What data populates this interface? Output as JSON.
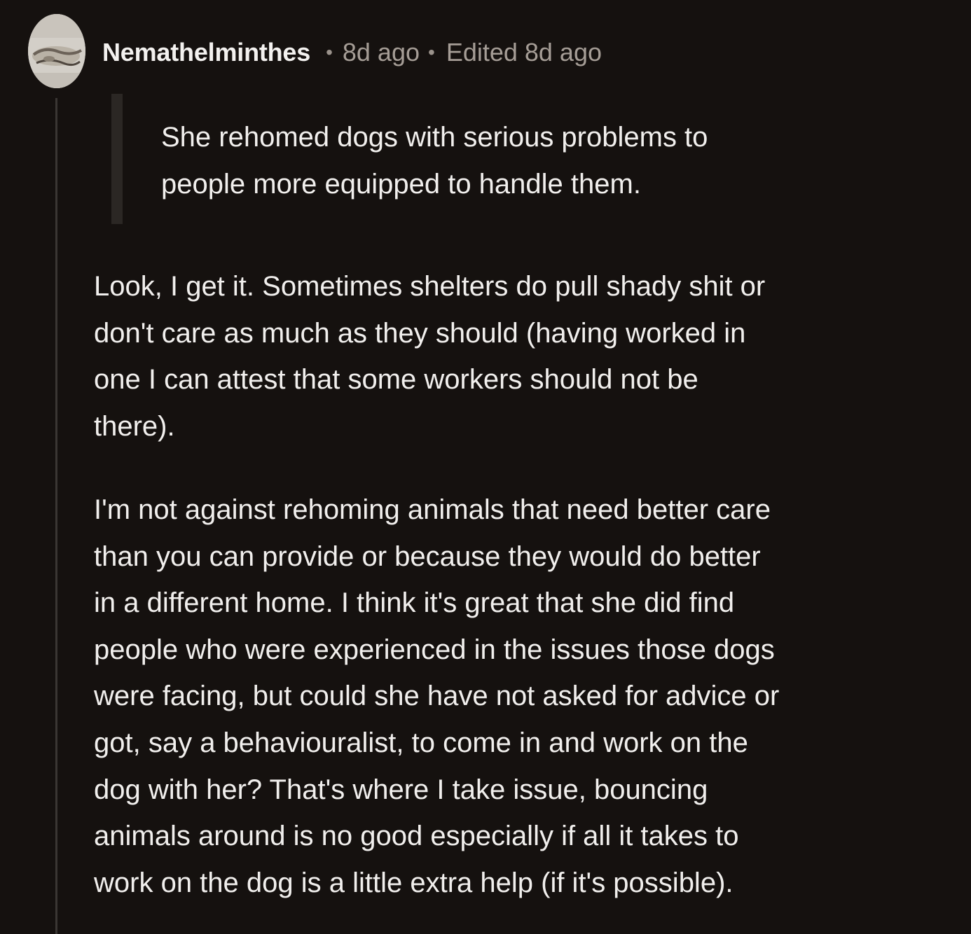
{
  "comment": {
    "author": "Nemathelminthes",
    "separator": "•",
    "time": "8d ago",
    "edited": "Edited 8d ago",
    "quote_lines": [
      "She rehomed dogs with serious problems to",
      "people more equipped to handle them."
    ],
    "paragraph1_lines": [
      "Look, I get it. Sometimes shelters do pull shady shit or",
      "don't care as much as they should (having worked in",
      "one I can attest that some workers should not be",
      "there)."
    ],
    "paragraph2_lines": [
      "I'm not against rehoming animals that need better care",
      "than you can provide or because they would do better",
      "in a different home. I think it's great that she did find",
      "people who were experienced in the issues those dogs",
      "were facing, but could she have not asked for advice or",
      "got, say a behaviouralist, to come in and work on the",
      "dog with her? That's where I take issue, bouncing",
      "animals around is no good especially if all it takes to",
      "work on the dog is a little extra help (if it's possible)."
    ]
  }
}
